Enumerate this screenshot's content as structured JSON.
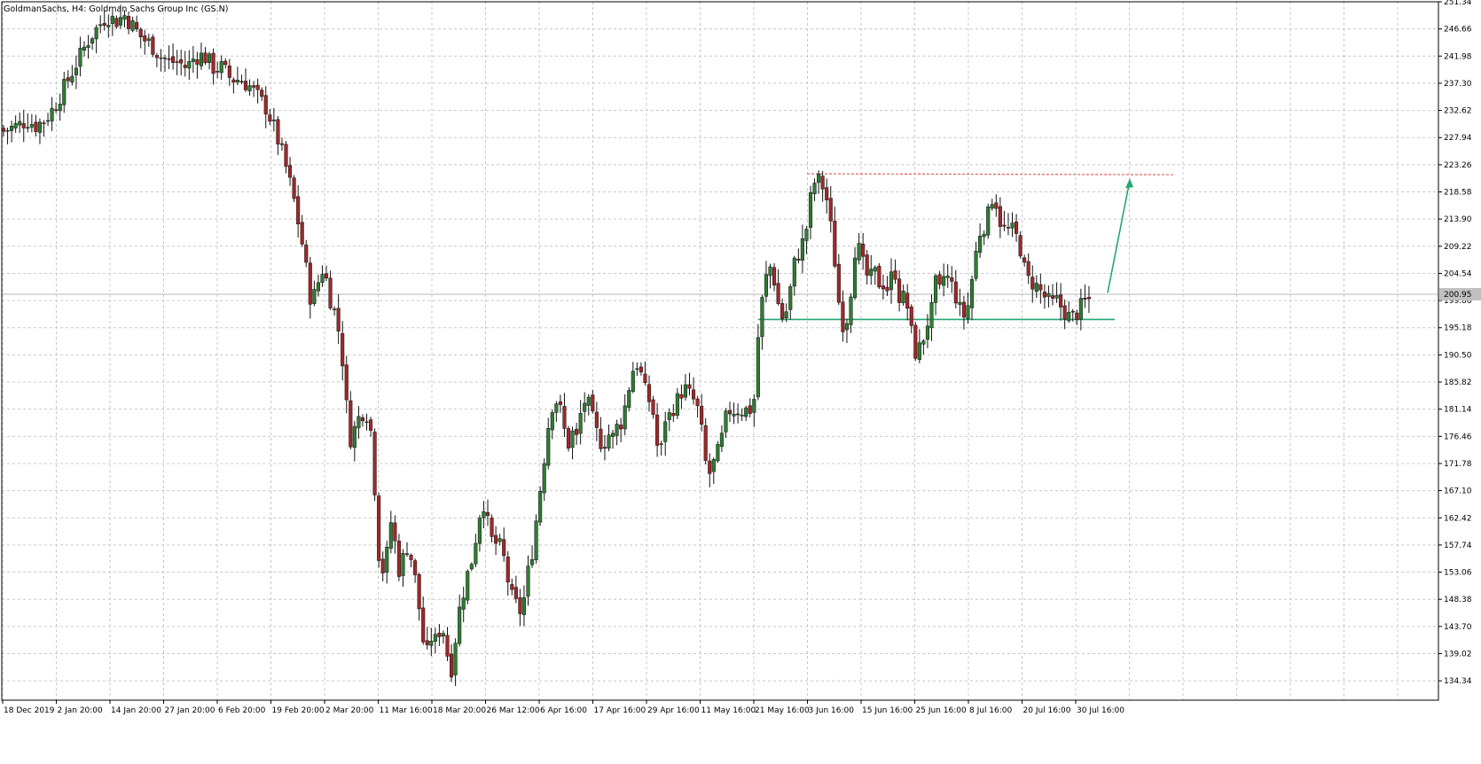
{
  "chart_data": {
    "type": "candlestick",
    "title": "GoldmanSachs, H4:  Goldman Sachs Group Inc (GS.N)",
    "ylim": [
      131.0,
      251.34
    ],
    "grid": true,
    "current_price": "200.95",
    "y_ticks": [
      "251.34",
      "246.66",
      "241.98",
      "237.30",
      "232.62",
      "227.94",
      "223.26",
      "218.58",
      "213.90",
      "209.22",
      "204.54",
      "199.86",
      "195.18",
      "190.50",
      "185.82",
      "181.14",
      "176.46",
      "171.78",
      "167.10",
      "162.42",
      "157.74",
      "153.06",
      "148.38",
      "143.70",
      "139.02",
      "134.34"
    ],
    "x_ticks": [
      "18 Dec 2019",
      "2 Jan 20:00",
      "14 Jan 20:00",
      "27 Jan 20:00",
      "6 Feb 20:00",
      "19 Feb 20:00",
      "2 Mar 20:00",
      "11 Mar 16:00",
      "18 Mar 20:00",
      "26 Mar 12:00",
      "6 Apr 16:00",
      "17 Apr 16:00",
      "29 Apr 16:00",
      "11 May 16:00",
      "21 May 16:00",
      "3 Jun 16:00",
      "15 Jun 16:00",
      "25 Jun 16:00",
      "8 Jul 16:00",
      "20 Jul 16:00",
      "30 Jul 16:00"
    ],
    "price_anchors": [
      [
        0,
        229.5
      ],
      [
        8,
        229
      ],
      [
        15,
        229.5
      ],
      [
        25,
        230
      ],
      [
        35,
        231
      ],
      [
        45,
        230
      ],
      [
        55,
        231
      ],
      [
        65,
        233
      ],
      [
        75,
        236
      ],
      [
        85,
        239
      ],
      [
        95,
        242
      ],
      [
        105,
        245
      ],
      [
        115,
        247
      ],
      [
        125,
        249
      ],
      [
        135,
        248
      ],
      [
        145,
        249
      ],
      [
        155,
        247
      ],
      [
        165,
        245
      ],
      [
        175,
        244
      ],
      [
        185,
        242
      ],
      [
        195,
        241
      ],
      [
        205,
        241
      ],
      [
        215,
        240
      ],
      [
        225,
        242
      ],
      [
        235,
        242
      ],
      [
        245,
        240
      ],
      [
        255,
        240
      ],
      [
        265,
        238
      ],
      [
        275,
        238
      ],
      [
        285,
        237
      ],
      [
        295,
        235
      ],
      [
        305,
        233
      ],
      [
        315,
        229
      ],
      [
        325,
        224
      ],
      [
        335,
        218
      ],
      [
        345,
        210
      ],
      [
        350,
        205
      ],
      [
        355,
        200
      ],
      [
        360,
        201
      ],
      [
        365,
        204
      ],
      [
        370,
        206
      ],
      [
        375,
        201
      ],
      [
        380,
        199
      ],
      [
        385,
        196
      ],
      [
        390,
        191
      ],
      [
        395,
        182
      ],
      [
        400,
        176
      ],
      [
        405,
        178
      ],
      [
        410,
        180
      ],
      [
        415,
        181
      ],
      [
        420,
        180
      ],
      [
        425,
        175
      ],
      [
        430,
        158
      ],
      [
        435,
        153
      ],
      [
        440,
        155
      ],
      [
        445,
        162
      ],
      [
        450,
        158
      ],
      [
        455,
        153
      ],
      [
        460,
        156
      ],
      [
        465,
        158
      ],
      [
        470,
        154
      ],
      [
        475,
        150
      ],
      [
        480,
        143
      ],
      [
        485,
        138
      ],
      [
        490,
        142
      ],
      [
        495,
        141
      ],
      [
        500,
        143
      ],
      [
        505,
        143
      ],
      [
        510,
        138
      ],
      [
        515,
        136
      ],
      [
        520,
        145
      ],
      [
        525,
        148
      ],
      [
        530,
        152
      ],
      [
        535,
        154
      ],
      [
        540,
        158
      ],
      [
        545,
        163
      ],
      [
        550,
        165
      ],
      [
        555,
        161
      ],
      [
        560,
        158
      ],
      [
        565,
        158
      ],
      [
        570,
        157
      ],
      [
        575,
        154
      ],
      [
        580,
        149
      ],
      [
        585,
        148
      ],
      [
        590,
        146
      ],
      [
        595,
        148
      ],
      [
        600,
        153
      ],
      [
        605,
        157
      ],
      [
        610,
        163
      ],
      [
        615,
        169
      ],
      [
        620,
        175
      ],
      [
        625,
        181
      ],
      [
        630,
        183
      ],
      [
        635,
        182
      ],
      [
        640,
        178
      ],
      [
        645,
        175
      ],
      [
        650,
        177
      ],
      [
        655,
        176
      ],
      [
        660,
        181
      ],
      [
        665,
        183
      ],
      [
        670,
        181
      ],
      [
        675,
        178
      ],
      [
        680,
        176
      ],
      [
        685,
        175
      ],
      [
        690,
        177
      ],
      [
        695,
        176
      ],
      [
        700,
        178
      ],
      [
        705,
        179
      ],
      [
        710,
        182
      ],
      [
        715,
        186
      ],
      [
        720,
        189
      ],
      [
        725,
        189
      ],
      [
        730,
        185
      ],
      [
        735,
        183
      ],
      [
        740,
        182
      ],
      [
        745,
        175
      ],
      [
        750,
        174
      ],
      [
        755,
        180
      ],
      [
        760,
        180
      ],
      [
        765,
        182
      ],
      [
        770,
        183
      ],
      [
        775,
        185
      ],
      [
        780,
        184
      ],
      [
        785,
        183
      ],
      [
        790,
        182
      ],
      [
        795,
        178
      ],
      [
        800,
        172
      ],
      [
        805,
        170
      ],
      [
        810,
        172
      ],
      [
        815,
        174
      ],
      [
        820,
        177
      ],
      [
        825,
        181
      ],
      [
        830,
        181
      ],
      [
        835,
        181
      ],
      [
        840,
        181
      ],
      [
        845,
        181
      ],
      [
        850,
        181
      ],
      [
        855,
        183
      ],
      [
        860,
        195
      ],
      [
        865,
        201
      ],
      [
        870,
        205
      ],
      [
        875,
        206
      ],
      [
        880,
        201
      ],
      [
        885,
        197
      ],
      [
        890,
        197
      ],
      [
        895,
        201
      ],
      [
        900,
        206
      ],
      [
        905,
        208
      ],
      [
        910,
        210
      ],
      [
        915,
        213
      ],
      [
        920,
        219
      ],
      [
        925,
        221
      ],
      [
        930,
        220
      ],
      [
        935,
        219
      ],
      [
        940,
        214
      ],
      [
        945,
        208
      ],
      [
        950,
        200
      ],
      [
        955,
        196
      ],
      [
        960,
        197
      ],
      [
        965,
        203
      ],
      [
        970,
        211
      ],
      [
        975,
        207
      ],
      [
        980,
        205
      ],
      [
        985,
        203
      ],
      [
        990,
        205
      ],
      [
        995,
        203
      ],
      [
        1000,
        203
      ],
      [
        1005,
        202
      ],
      [
        1010,
        204
      ],
      [
        1015,
        205
      ],
      [
        1020,
        199
      ],
      [
        1025,
        201
      ],
      [
        1030,
        197
      ],
      [
        1035,
        191
      ],
      [
        1040,
        191
      ],
      [
        1045,
        193
      ],
      [
        1050,
        196
      ],
      [
        1055,
        198
      ],
      [
        1060,
        203
      ],
      [
        1065,
        201
      ],
      [
        1070,
        205
      ],
      [
        1075,
        203
      ],
      [
        1080,
        202
      ],
      [
        1085,
        199
      ],
      [
        1090,
        197
      ],
      [
        1095,
        198
      ],
      [
        1100,
        203
      ],
      [
        1105,
        208
      ],
      [
        1110,
        212
      ],
      [
        1115,
        213
      ],
      [
        1120,
        215
      ],
      [
        1125,
        219
      ],
      [
        1130,
        215
      ],
      [
        1135,
        212
      ],
      [
        1140,
        212
      ],
      [
        1145,
        212
      ],
      [
        1150,
        211
      ],
      [
        1155,
        209
      ],
      [
        1160,
        205
      ],
      [
        1165,
        203
      ],
      [
        1170,
        203
      ],
      [
        1175,
        202
      ],
      [
        1180,
        201
      ],
      [
        1185,
        200
      ],
      [
        1190,
        199
      ],
      [
        1195,
        200
      ],
      [
        1200,
        199
      ],
      [
        1205,
        198
      ],
      [
        1210,
        197
      ],
      [
        1215,
        197
      ],
      [
        1220,
        198
      ],
      [
        1225,
        199
      ],
      [
        1230,
        200
      ]
    ]
  },
  "annotations": {
    "resistance_color": "#e06060",
    "support_color": "#26a870",
    "arrow_color": "#26a870",
    "bull_color": "#2e7d32",
    "bear_color": "#a0282a",
    "wick_color": "#111111",
    "grid_color": "#c8c8c8"
  }
}
